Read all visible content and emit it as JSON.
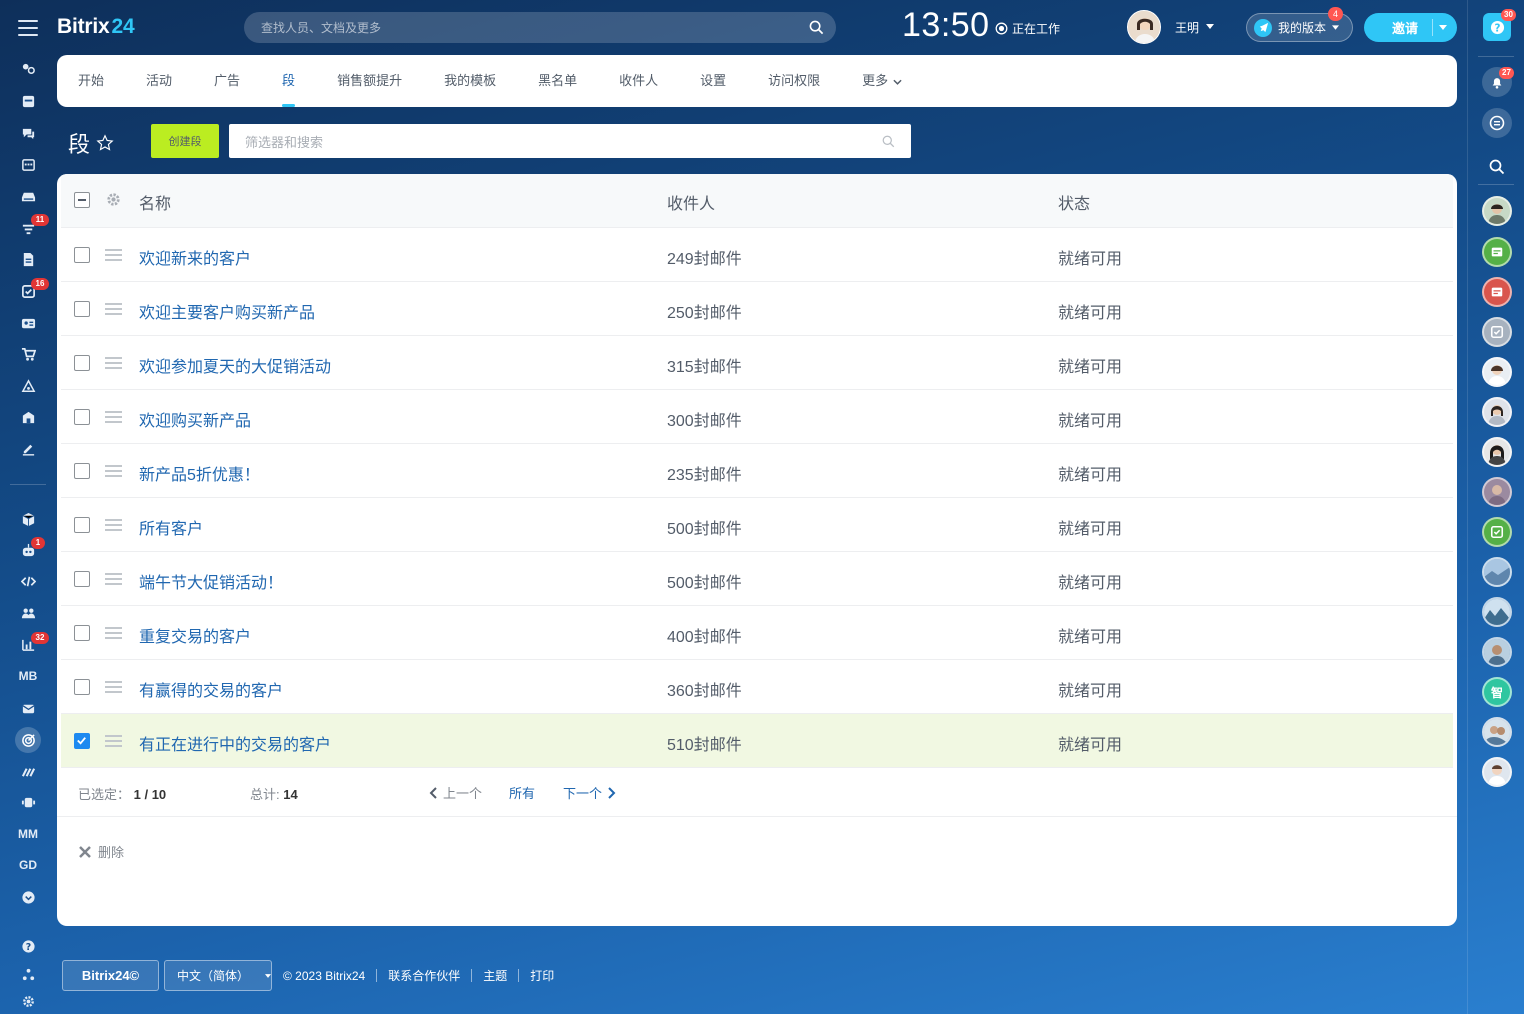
{
  "app": {
    "logo_main": "Bitrix",
    "logo_accent": "24"
  },
  "header": {
    "search_placeholder": "查找人员、文档及更多",
    "clock": "13:50",
    "work_status": "正在工作",
    "user_name": "王明",
    "plan_label": "我的版本",
    "plan_badge": "4",
    "invite_label": "邀请"
  },
  "left_sidebar": {
    "badges": {
      "filter": "11",
      "tasks": "16",
      "bot": "1",
      "monitor": "32"
    },
    "text_items": {
      "mb": "MB",
      "mm": "MM",
      "gd": "GD"
    }
  },
  "right_sidebar": {
    "help_badge": "30",
    "notifications_badge": "27",
    "chat_initial": "智"
  },
  "tabs": [
    {
      "label": "开始"
    },
    {
      "label": "活动"
    },
    {
      "label": "广告"
    },
    {
      "label": "段",
      "active": true
    },
    {
      "label": "销售额提升"
    },
    {
      "label": "我的模板"
    },
    {
      "label": "黑名单"
    },
    {
      "label": "收件人"
    },
    {
      "label": "设置"
    },
    {
      "label": "访问权限"
    },
    {
      "label": "更多"
    }
  ],
  "page": {
    "title": "段",
    "create_button": "创建段",
    "filter_placeholder": "筛选器和搜索"
  },
  "grid": {
    "columns": [
      "名称",
      "收件人",
      "状态"
    ],
    "rows": [
      {
        "name": "欢迎新来的客户",
        "recipients": "249封邮件",
        "status": "就绪可用",
        "selected": false
      },
      {
        "name": "欢迎主要客户购买新产品",
        "recipients": "250封邮件",
        "status": "就绪可用",
        "selected": false
      },
      {
        "name": "欢迎参加夏天的大促销活动",
        "recipients": "315封邮件",
        "status": "就绪可用",
        "selected": false
      },
      {
        "name": "欢迎购买新产品",
        "recipients": "300封邮件",
        "status": "就绪可用",
        "selected": false
      },
      {
        "name": "新产品5折优惠！",
        "recipients": "235封邮件",
        "status": "就绪可用",
        "selected": false
      },
      {
        "name": "所有客户",
        "recipients": "500封邮件",
        "status": "就绪可用",
        "selected": false
      },
      {
        "name": "端午节大促销活动！",
        "recipients": "500封邮件",
        "status": "就绪可用",
        "selected": false
      },
      {
        "name": "重复交易的客户",
        "recipients": "400封邮件",
        "status": "就绪可用",
        "selected": false
      },
      {
        "name": "有赢得的交易的客户",
        "recipients": "360封邮件",
        "status": "就绪可用",
        "selected": false
      },
      {
        "name": "有正在进行中的交易的客户",
        "recipients": "510封邮件",
        "status": "就绪可用",
        "selected": true
      }
    ],
    "footer": {
      "selected_label": "已选定：",
      "selected_value": "1 / 10",
      "total_label": "总计:",
      "total_value": "14",
      "prev": "上一个",
      "all": "所有",
      "next": "下一个",
      "delete": "删除"
    }
  },
  "footer": {
    "logo": "Bitrix24©",
    "language": "中文（简体）",
    "copyright": "© 2023 Bitrix24",
    "links": [
      "联系合作伙伴",
      "主题",
      "打印"
    ]
  },
  "colors": {
    "accent": "#2fc6f6",
    "create_button": "#bbed21",
    "link": "#2067b0",
    "selected_row": "#f1f8e2",
    "badge": "#e13535"
  }
}
